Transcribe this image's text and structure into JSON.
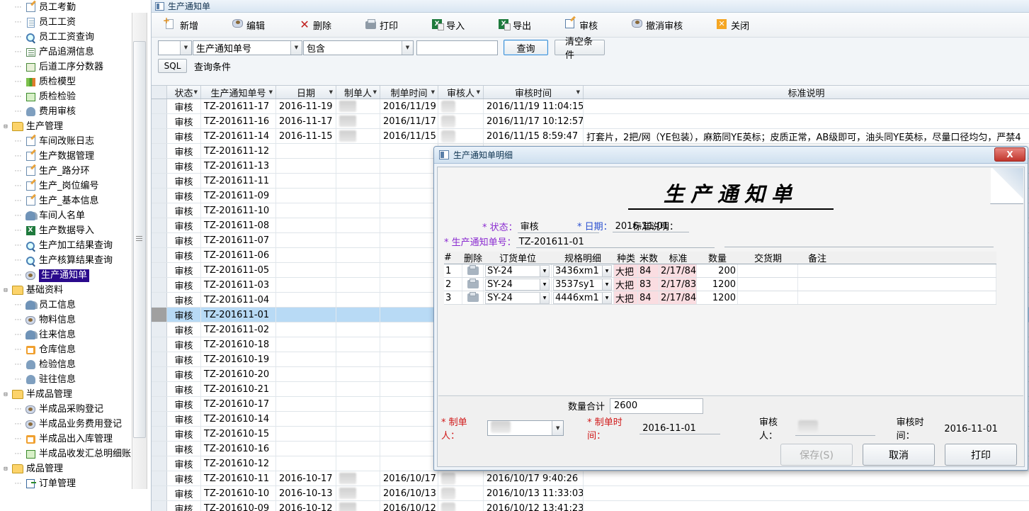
{
  "sidebar": {
    "items": [
      {
        "label": "员工考勤",
        "icon": "person-badge-icon",
        "level": 2,
        "type": "leaf",
        "iconclass": "ic-pencil"
      },
      {
        "label": "员工工资",
        "icon": "document-icon",
        "level": 2,
        "type": "leaf",
        "iconclass": "ic-doc"
      },
      {
        "label": "员工工资查询",
        "icon": "magnifier-icon",
        "level": 2,
        "type": "leaf",
        "iconclass": "ic-magnify"
      },
      {
        "label": "产品追溯信息",
        "icon": "list-icon",
        "level": 2,
        "type": "leaf",
        "iconclass": "ic-list"
      },
      {
        "label": "后道工序分数器",
        "icon": "grid-icon",
        "level": 2,
        "type": "leaf",
        "iconclass": "ic-grid"
      },
      {
        "label": "质检模型",
        "icon": "bar-chart-icon",
        "level": 2,
        "type": "leaf",
        "iconclass": "ic-bar"
      },
      {
        "label": "质检检验",
        "icon": "green-form-icon",
        "level": 2,
        "type": "leaf",
        "iconclass": "ic-green"
      },
      {
        "label": "费用审核",
        "icon": "person-card-icon",
        "level": 2,
        "type": "leaf",
        "iconclass": "ic-person"
      },
      {
        "label": "生产管理",
        "icon": "folder-icon",
        "level": 1,
        "type": "folder",
        "iconclass": "ic-folder"
      },
      {
        "label": "车间改账日志",
        "icon": "person-badge-icon",
        "level": 2,
        "type": "leaf",
        "iconclass": "ic-pencil"
      },
      {
        "label": "生产数据管理",
        "icon": "pencil-icon",
        "level": 2,
        "type": "leaf",
        "iconclass": "ic-pencil"
      },
      {
        "label": "生产_路分环",
        "icon": "pencil-icon",
        "level": 2,
        "type": "leaf",
        "iconclass": "ic-pencil"
      },
      {
        "label": "生产_岗位编号",
        "icon": "pencil-icon",
        "level": 2,
        "type": "leaf",
        "iconclass": "ic-pencil"
      },
      {
        "label": "生产_基本信息",
        "icon": "pencil-icon",
        "level": 2,
        "type": "leaf",
        "iconclass": "ic-pencil"
      },
      {
        "label": "车间人名单",
        "icon": "people-icon",
        "level": 2,
        "type": "leaf",
        "iconclass": "ic-people"
      },
      {
        "label": "生产数据导入",
        "icon": "excel-import-icon",
        "level": 2,
        "type": "leaf",
        "iconclass": "ic-excel"
      },
      {
        "label": "生产加工结果查询",
        "icon": "magnifier-icon",
        "level": 2,
        "type": "leaf",
        "iconclass": "ic-magnify"
      },
      {
        "label": "生产核算结果查询",
        "icon": "magnifier-icon",
        "level": 2,
        "type": "leaf",
        "iconclass": "ic-magnify"
      },
      {
        "label": "生产通知单",
        "icon": "ribbon-icon",
        "level": 2,
        "type": "leaf",
        "selected": true,
        "iconclass": "ic-ribbon"
      },
      {
        "label": "基础资料",
        "icon": "folder-icon",
        "level": 1,
        "type": "folder",
        "iconclass": "ic-folder"
      },
      {
        "label": "员工信息",
        "icon": "people-icon",
        "level": 2,
        "type": "leaf",
        "iconclass": "ic-people"
      },
      {
        "label": "物料信息",
        "icon": "ribbon-icon",
        "level": 2,
        "type": "leaf",
        "iconclass": "ic-ribbon"
      },
      {
        "label": "往来信息",
        "icon": "people-icon",
        "level": 2,
        "type": "leaf",
        "iconclass": "ic-people"
      },
      {
        "label": "仓库信息",
        "icon": "house-icon",
        "level": 2,
        "type": "leaf",
        "iconclass": "ic-house"
      },
      {
        "label": "检验信息",
        "icon": "person-card-icon",
        "level": 2,
        "type": "leaf",
        "iconclass": "ic-person"
      },
      {
        "label": "驻往信息",
        "icon": "person-icon",
        "level": 2,
        "type": "leaf",
        "iconclass": "ic-person"
      },
      {
        "label": "半成品管理",
        "icon": "folder-icon",
        "level": 1,
        "type": "folder",
        "iconclass": "ic-folder"
      },
      {
        "label": "半成品采购登记",
        "icon": "ribbon-icon",
        "level": 2,
        "type": "leaf",
        "iconclass": "ic-ribbon"
      },
      {
        "label": "半成品业务费用登记",
        "icon": "ribbon-icon",
        "level": 2,
        "type": "leaf",
        "iconclass": "ic-ribbon"
      },
      {
        "label": "半成品出入库管理",
        "icon": "house-icon",
        "level": 2,
        "type": "leaf",
        "iconclass": "ic-house"
      },
      {
        "label": "半成品收发汇总明细账",
        "icon": "green-form-icon",
        "level": 2,
        "type": "leaf",
        "iconclass": "ic-green"
      },
      {
        "label": "成品管理",
        "icon": "folder-icon",
        "level": 1,
        "type": "folder",
        "iconclass": "ic-folder"
      },
      {
        "label": "订单管理",
        "icon": "order-icon",
        "level": 2,
        "type": "leaf",
        "iconclass": "ic-ord"
      }
    ]
  },
  "window": {
    "title": "生产通知单"
  },
  "toolbar": {
    "buttons": [
      {
        "label": "新增",
        "icon": "new-icon"
      },
      {
        "label": "编辑",
        "icon": "edit-icon"
      },
      {
        "label": "删除",
        "icon": "delete-icon"
      },
      {
        "label": "打印",
        "icon": "print-icon"
      },
      {
        "label": "导入",
        "icon": "import-icon"
      },
      {
        "label": "导出",
        "icon": "export-icon"
      },
      {
        "label": "审核",
        "icon": "audit-icon"
      },
      {
        "label": "撤消审核",
        "icon": "unaudit-icon"
      },
      {
        "label": "关闭",
        "icon": "close-icon"
      }
    ]
  },
  "filterbar": {
    "logic_value": "",
    "field_value": "生产通知单号",
    "operator_value": "包含",
    "keyword_value": "",
    "keyword_placeholder": "",
    "search_label": "查询",
    "clear_label": "清空条件"
  },
  "sqlbar": {
    "sql_label": "SQL",
    "condition_text": "查询条件"
  },
  "grid": {
    "columns": [
      "状态",
      "生产通知单号",
      "日期",
      "制单人",
      "制单时间",
      "审核人",
      "审核时间",
      "标准说明"
    ],
    "rows": [
      {
        "status": "审核",
        "no": "TZ-201611-17",
        "date": "2016-11-19",
        "maker": "",
        "mtime": "2016/11/19",
        "auditor": "",
        "atime": "2016/11/19 11:04:15",
        "desc": ""
      },
      {
        "status": "审核",
        "no": "TZ-201611-16",
        "date": "2016-11-17",
        "maker": "",
        "mtime": "2016/11/17",
        "auditor": "",
        "atime": "2016/11/17 10:12:57",
        "desc": ""
      },
      {
        "status": "审核",
        "no": "TZ-201611-14",
        "date": "2016-11-15",
        "maker": "",
        "mtime": "2016/11/15",
        "auditor": "",
        "atime": "2016/11/15 8:59:47",
        "desc": "打套片，2把/网（YE包装），麻筋同YE英标；皮质正常，AB级即可，油头同YE英标，尽量口径均匀，严禁4"
      },
      {
        "status": "审核",
        "no": "TZ-201611-12",
        "date": "",
        "maker": "",
        "mtime": "",
        "auditor": "",
        "atime": "",
        "desc": ""
      },
      {
        "status": "审核",
        "no": "TZ-201611-13",
        "date": "",
        "maker": "",
        "mtime": "",
        "auditor": "",
        "atime": "",
        "desc": ""
      },
      {
        "status": "审核",
        "no": "TZ-201611-11",
        "date": "",
        "maker": "",
        "mtime": "",
        "auditor": "",
        "atime": "",
        "desc": ""
      },
      {
        "status": "审核",
        "no": "TZ-201611-09",
        "date": "",
        "maker": "",
        "mtime": "",
        "auditor": "",
        "atime": "",
        "desc": ""
      },
      {
        "status": "审核",
        "no": "TZ-201611-10",
        "date": "",
        "maker": "",
        "mtime": "",
        "auditor": "",
        "atime": "",
        "desc": ""
      },
      {
        "status": "审核",
        "no": "TZ-201611-08",
        "date": "",
        "maker": "",
        "mtime": "",
        "auditor": "",
        "atime": "",
        "desc": ""
      },
      {
        "status": "审核",
        "no": "TZ-201611-07",
        "date": "",
        "maker": "",
        "mtime": "",
        "auditor": "",
        "atime": "",
        "desc": ""
      },
      {
        "status": "审核",
        "no": "TZ-201611-06",
        "date": "",
        "maker": "",
        "mtime": "",
        "auditor": "",
        "atime": "",
        "desc": ""
      },
      {
        "status": "审核",
        "no": "TZ-201611-05",
        "date": "",
        "maker": "",
        "mtime": "",
        "auditor": "",
        "atime": "",
        "desc": ""
      },
      {
        "status": "审核",
        "no": "TZ-201611-03",
        "date": "",
        "maker": "",
        "mtime": "",
        "auditor": "",
        "atime": "",
        "desc": ""
      },
      {
        "status": "审核",
        "no": "TZ-201611-04",
        "date": "",
        "maker": "",
        "mtime": "",
        "auditor": "",
        "atime": "",
        "desc": ""
      },
      {
        "status": "审核",
        "no": "TZ-201611-01",
        "date": "",
        "maker": "",
        "mtime": "",
        "auditor": "",
        "atime": "",
        "desc": "",
        "selected": true
      },
      {
        "status": "审核",
        "no": "TZ-201611-02",
        "date": "",
        "maker": "",
        "mtime": "",
        "auditor": "",
        "atime": "",
        "desc": ""
      },
      {
        "status": "审核",
        "no": "TZ-201610-18",
        "date": "",
        "maker": "",
        "mtime": "",
        "auditor": "",
        "atime": "",
        "desc": ""
      },
      {
        "status": "审核",
        "no": "TZ-201610-19",
        "date": "",
        "maker": "",
        "mtime": "",
        "auditor": "",
        "atime": "",
        "desc": ""
      },
      {
        "status": "审核",
        "no": "TZ-201610-20",
        "date": "",
        "maker": "",
        "mtime": "",
        "auditor": "",
        "atime": "",
        "desc": ""
      },
      {
        "status": "审核",
        "no": "TZ-201610-21",
        "date": "",
        "maker": "",
        "mtime": "",
        "auditor": "",
        "atime": "",
        "desc": ""
      },
      {
        "status": "审核",
        "no": "TZ-201610-17",
        "date": "",
        "maker": "",
        "mtime": "",
        "auditor": "",
        "atime": "",
        "desc": ""
      },
      {
        "status": "审核",
        "no": "TZ-201610-14",
        "date": "",
        "maker": "",
        "mtime": "",
        "auditor": "",
        "atime": "",
        "desc": ""
      },
      {
        "status": "审核",
        "no": "TZ-201610-15",
        "date": "",
        "maker": "",
        "mtime": "",
        "auditor": "",
        "atime": "",
        "desc": ""
      },
      {
        "status": "审核",
        "no": "TZ-201610-16",
        "date": "",
        "maker": "",
        "mtime": "",
        "auditor": "",
        "atime": "",
        "desc": ""
      },
      {
        "status": "审核",
        "no": "TZ-201610-12",
        "date": "",
        "maker": "",
        "mtime": "",
        "auditor": "",
        "atime": "",
        "desc": ""
      },
      {
        "status": "审核",
        "no": "TZ-201610-11",
        "date": "2016-10-17",
        "maker": "",
        "mtime": "2016/10/17",
        "auditor": "",
        "atime": "2016/10/17 9:40:26",
        "desc": ""
      },
      {
        "status": "审核",
        "no": "TZ-201610-10",
        "date": "2016-10-13",
        "maker": "",
        "mtime": "2016/10/13",
        "auditor": "",
        "atime": "2016/10/13 11:33:03",
        "desc": ""
      },
      {
        "status": "审核",
        "no": "TZ-201610-09",
        "date": "2016-10-12",
        "maker": "",
        "mtime": "2016/10/12",
        "auditor": "",
        "atime": "2016/10/12 13:41:23",
        "desc": ""
      }
    ]
  },
  "modal": {
    "title": "生产通知单明细",
    "close_label": "X",
    "doc_title": "生产通知单",
    "fields": {
      "status_label": "* 状态：",
      "status_value": "审核",
      "date_label": "* 日期：",
      "date_value": "2016-11-01",
      "stdnote_label": "标准说明：",
      "stdnote_value": "",
      "no_label": "* 生产通知单号：",
      "no_value": "TZ-201611-01"
    },
    "detail_columns": [
      "#",
      "删除",
      "订货单位",
      "规格明细",
      "种类",
      "米数",
      "标准",
      "数量",
      "交货期",
      "备注"
    ],
    "detail_rows": [
      {
        "idx": "1",
        "unit": "SY-24",
        "spec": "3436xm1",
        "kind": "大把",
        "meters": "84",
        "standard": "2/17/84",
        "qty": "200",
        "due": "",
        "remark": ""
      },
      {
        "idx": "2",
        "unit": "SY-24",
        "spec": "3537sy1",
        "kind": "大把",
        "meters": "83",
        "standard": "2/17/83",
        "qty": "1200",
        "due": "",
        "remark": ""
      },
      {
        "idx": "3",
        "unit": "SY-24",
        "spec": "4446xm1",
        "kind": "大把",
        "meters": "84",
        "standard": "2/17/84",
        "qty": "1200",
        "due": "",
        "remark": ""
      }
    ],
    "total_label": "数量合计",
    "total_value": "2600",
    "footer": {
      "maker_label": "* 制单人：",
      "maker_value": "",
      "mtime_label": "* 制单时间：",
      "mtime_value": "2016-11-01",
      "auditor_label": "审核人：",
      "auditor_value": "",
      "atime_label": "审核时间：",
      "atime_value": "2016-11-01"
    },
    "buttons": {
      "save_label": "保存(S)",
      "cancel_label": "取消",
      "print_label": "打印"
    }
  },
  "colors": {
    "selection_blue": "#b8daf5",
    "tree_selection": "#2a0a8c",
    "required_red": "#d01818",
    "label_blue": "#2a4fd0",
    "label_purple": "#8a2ad0",
    "pink_cell": "#fadde1",
    "close_red": "#c0352c"
  }
}
